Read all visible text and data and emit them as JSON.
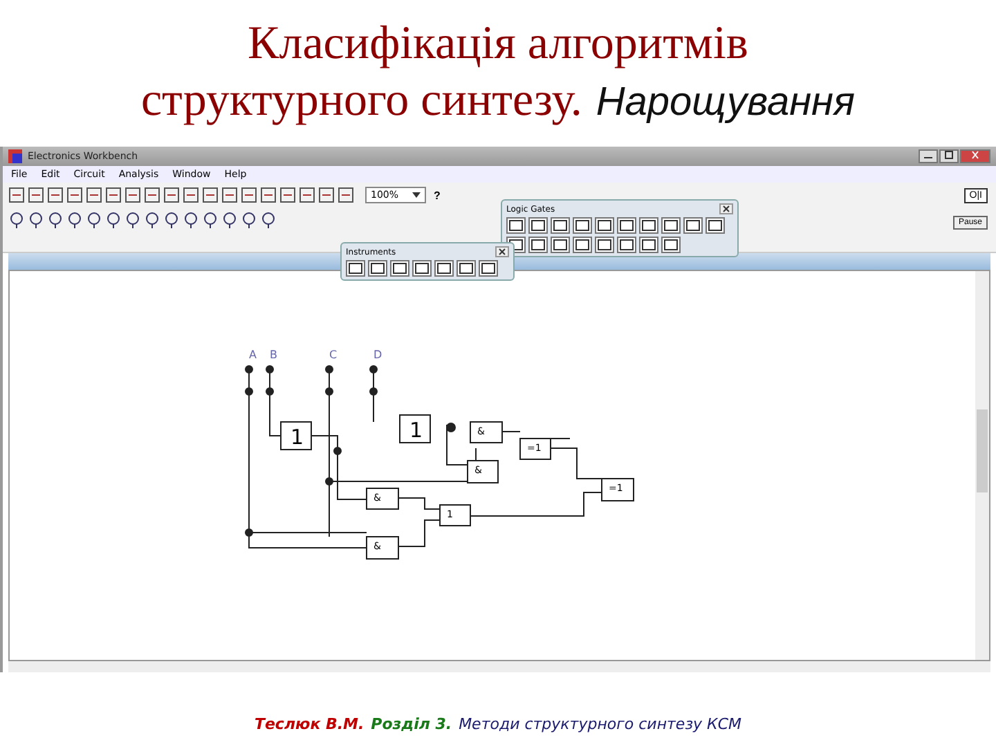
{
  "slide_title": {
    "line_1": "Класифікація алгоритмів",
    "line_2_serif": "структурного синтезу.",
    "line_2_sans": "Нарощування"
  },
  "window": {
    "title": "Electronics Workbench",
    "menu": [
      {
        "label": "File"
      },
      {
        "label": "Edit"
      },
      {
        "label": "Circuit"
      },
      {
        "label": "Analysis"
      },
      {
        "label": "Window"
      },
      {
        "label": "Help"
      }
    ],
    "zoom": "100%",
    "help": "?",
    "power_switch": "O|I",
    "power_on": false,
    "pause": "Pause",
    "instruments_palette": {
      "title": "Instruments"
    },
    "logic_gates_palette": {
      "title": "Logic Gates"
    },
    "circuit": {
      "inputs": [
        {
          "label": "A"
        },
        {
          "label": "B"
        },
        {
          "label": "C"
        },
        {
          "label": "D"
        }
      ],
      "gates": [
        {
          "label": "1"
        },
        {
          "label": "1"
        },
        {
          "label": "&"
        },
        {
          "label": "&"
        },
        {
          "label": "&"
        },
        {
          "label": "&"
        },
        {
          "label": "1"
        },
        {
          "label": "=1"
        },
        {
          "label": "=1"
        }
      ]
    }
  },
  "footer": [
    {
      "text": "Теслюк В.М.",
      "color": "#c00000"
    },
    {
      "text": "Розділ 3.",
      "color": "#1a7a1a"
    },
    {
      "text": "Методи структурного синтезу КСМ",
      "color": "#1a1a6e"
    }
  ]
}
